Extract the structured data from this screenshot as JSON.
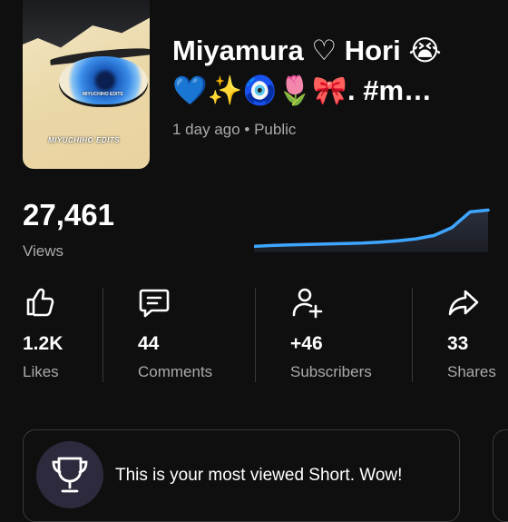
{
  "video": {
    "title_line1": "Miyamura ♡ Hori 😭",
    "title_line2": "💙✨🧿🌷🎀. #m…",
    "meta": "1 day ago • Public",
    "thumbnail": {
      "watermark": "MIYUCHIHO EDITS",
      "watermark_small": "MIYUCHIHO EDITS"
    }
  },
  "views": {
    "count": "27,461",
    "label": "Views",
    "trend_color": "#3ea6ff",
    "trend": [
      0.05,
      0.07,
      0.08,
      0.09,
      0.1,
      0.11,
      0.12,
      0.14,
      0.17,
      0.21,
      0.28,
      0.45,
      0.78,
      0.82
    ]
  },
  "stats": [
    {
      "icon": "thumbs-up-icon",
      "value": "1.2K",
      "label": "Likes"
    },
    {
      "icon": "comments-icon",
      "value": "44",
      "label": "Comments"
    },
    {
      "icon": "add-person-icon",
      "value": "+46",
      "label": "Subscribers"
    },
    {
      "icon": "share-icon",
      "value": "33",
      "label": "Shares"
    }
  ],
  "achievement": {
    "icon": "trophy-icon",
    "text": "This is your most viewed Short. Wow!",
    "icon_bg": "#2e2a3e"
  }
}
